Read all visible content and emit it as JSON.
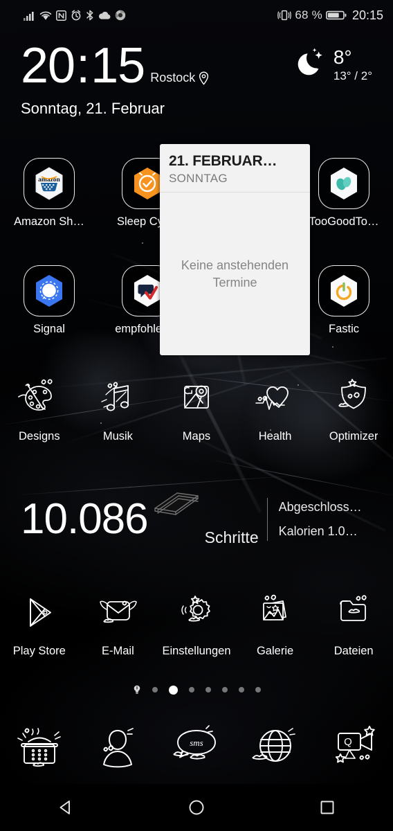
{
  "status_bar": {
    "left_icons": [
      {
        "name": "signal-bars-icon",
        "label": "Mobilfunk"
      },
      {
        "name": "wifi-icon",
        "label": "WLAN"
      },
      {
        "name": "nfc-icon",
        "label": "NFC"
      },
      {
        "name": "alarm-clock-icon",
        "label": "Wecker"
      },
      {
        "name": "bluetooth-icon",
        "label": "Bluetooth"
      },
      {
        "name": "cloud-icon",
        "label": "Cloud"
      },
      {
        "name": "chrome-icon",
        "label": "Chrome"
      }
    ],
    "vibrate_icon": "vibrate-icon",
    "battery_percent": "68 %",
    "battery_level": 68,
    "battery_icon": "battery-icon",
    "clock": "20:15"
  },
  "clock_widget": {
    "hours": "20",
    "separator": ":",
    "minutes": "15",
    "location": "Rostock",
    "location_icon": "location-pin-icon",
    "date": "Sonntag, 21. Februar",
    "weather": {
      "icon": "moon-stars-icon",
      "current": "8°",
      "range": "13° / 2°"
    }
  },
  "calendar_widget": {
    "title": "21. FEBRUAR…",
    "subtitle": "SONNTAG",
    "empty_message": "Keine anstehenden Termine",
    "background": "#f2f2f2"
  },
  "app_rows": [
    {
      "row": 1,
      "apps": [
        {
          "label": "Amazon Sh…",
          "icon": "amazon-shopping-icon",
          "style": "hex-ring",
          "color": "#ffffff",
          "accent": "#ff9900"
        },
        {
          "label": "Sleep Cycle",
          "icon": "sleep-cycle-icon",
          "style": "hex-ring",
          "color": "#f7931e",
          "accent": "#ffffff"
        },
        {
          "label": "",
          "icon": "",
          "style": "empty",
          "color": ""
        },
        {
          "label": "TooGoodTo…",
          "icon": "too-good-to-go-icon",
          "style": "hex-ring",
          "color": "#ffffff",
          "accent": "#3cb9a8"
        }
      ]
    },
    {
      "row": 2,
      "apps": [
        {
          "label": "Signal",
          "icon": "signal-messenger-icon",
          "style": "hex-ring",
          "color": "#3a76f0",
          "accent": "#ffffff"
        },
        {
          "label": "empfohlen…",
          "icon": "empfohlen-icon",
          "style": "hex-ring",
          "color": "#ffffff",
          "accent": "#1b2a4a"
        },
        {
          "label": "",
          "icon": "",
          "style": "empty",
          "color": ""
        },
        {
          "label": "Fastic",
          "icon": "fastic-icon",
          "style": "hex-ring",
          "color": "#ffffff",
          "accent": "#f5a623"
        }
      ]
    },
    {
      "row": 3,
      "apps": [
        {
          "label": "Designs",
          "icon": "palette-icon",
          "style": "line"
        },
        {
          "label": "Musik",
          "icon": "music-note-icon",
          "style": "line"
        },
        {
          "label": "Maps",
          "icon": "maps-icon",
          "style": "line"
        },
        {
          "label": "Health",
          "icon": "heart-pulse-icon",
          "style": "line"
        },
        {
          "label": "Optimizer",
          "icon": "shield-icon",
          "style": "line"
        }
      ]
    },
    {
      "row": 4,
      "apps": [
        {
          "label": "Play Store",
          "icon": "play-store-icon",
          "style": "line"
        },
        {
          "label": "E-Mail",
          "icon": "envelope-icon",
          "style": "line"
        },
        {
          "label": "Einstellungen",
          "icon": "gear-icon",
          "style": "line"
        },
        {
          "label": "Galerie",
          "icon": "gallery-icon",
          "style": "line"
        },
        {
          "label": "Dateien",
          "icon": "folder-icon",
          "style": "line"
        }
      ]
    }
  ],
  "steps_widget": {
    "count": "10.086",
    "unit": "Schritte",
    "book_icon": "book-icon",
    "stat_completed": "Abgeschloss…",
    "stat_calories": "Kalorien 1.0…"
  },
  "page_dots": {
    "count": 8,
    "active_index": 2,
    "home_index": 0
  },
  "dock": [
    {
      "name": "phone",
      "icon": "telephone-icon"
    },
    {
      "name": "contacts",
      "icon": "person-icon"
    },
    {
      "name": "messages",
      "icon": "sms-bubble-icon"
    },
    {
      "name": "browser",
      "icon": "globe-icon"
    },
    {
      "name": "camera",
      "icon": "video-camera-icon"
    }
  ],
  "nav_bar": [
    {
      "name": "back-button",
      "icon": "back-triangle-icon"
    },
    {
      "name": "home-button",
      "icon": "home-circle-icon"
    },
    {
      "name": "recents-button",
      "icon": "recents-square-icon"
    }
  ]
}
